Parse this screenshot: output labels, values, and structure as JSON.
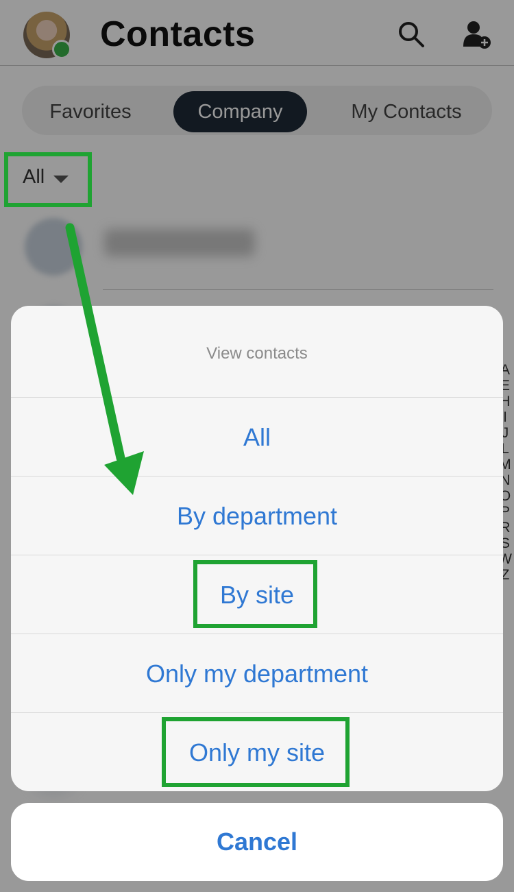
{
  "header": {
    "title": "Contacts",
    "search_icon": "search-icon",
    "add_contact_icon": "add-contact-icon"
  },
  "tabs": [
    {
      "label": "Favorites",
      "selected": false
    },
    {
      "label": "Company",
      "selected": true
    },
    {
      "label": "My Contacts",
      "selected": false
    }
  ],
  "filter": {
    "label": "All"
  },
  "index_letters": [
    "A",
    "E",
    "H",
    "I",
    "J",
    "L",
    "M",
    "N",
    "O",
    "P",
    "R",
    "S",
    "W",
    "Z"
  ],
  "action_sheet": {
    "title": "View contacts",
    "options": [
      "All",
      "By department",
      "By site",
      "Only my department",
      "Only my site"
    ],
    "cancel_label": "Cancel"
  },
  "colors": {
    "accent": "#2f78d3",
    "selected_tab_bg": "#1f2b38",
    "annotation": "#1fa332",
    "presence": "#3bb24a"
  }
}
